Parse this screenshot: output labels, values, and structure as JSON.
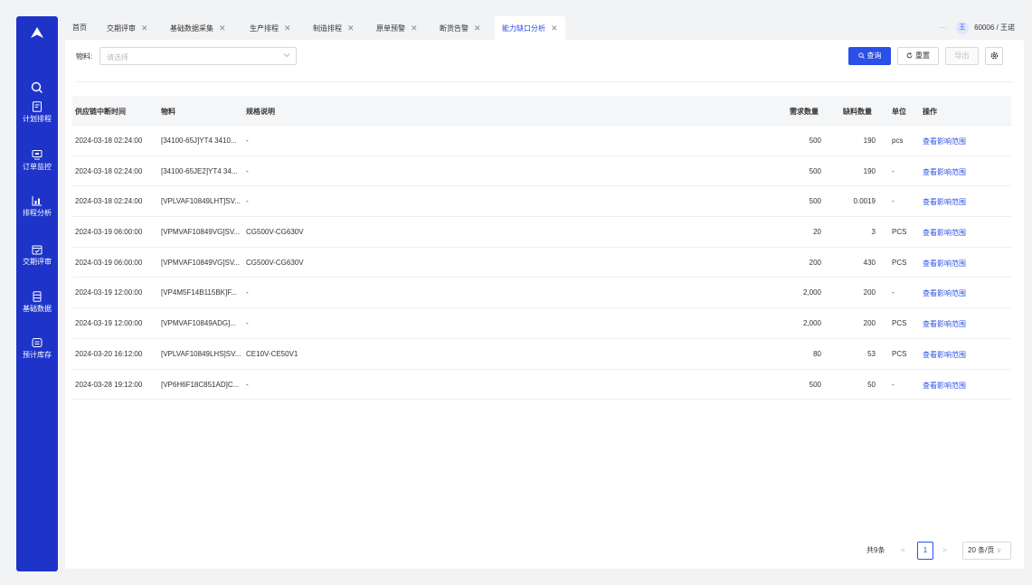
{
  "sidebar": {
    "logo_icon": "triangle-logo-icon",
    "search_icon": "search-icon",
    "items": [
      {
        "label": "计划排程",
        "icon": "document-icon"
      },
      {
        "label": "订单监控",
        "icon": "monitor-icon"
      },
      {
        "label": "排程分析",
        "icon": "chart-icon"
      },
      {
        "label": "交期评审",
        "icon": "calendar-icon"
      },
      {
        "label": "基础数据",
        "icon": "database-icon"
      },
      {
        "label": "预计库存",
        "icon": "box-icon"
      }
    ]
  },
  "tabs": [
    {
      "label": "首页",
      "closable": false
    },
    {
      "label": "交期评审",
      "closable": true
    },
    {
      "label": "基础数据采集",
      "closable": true
    },
    {
      "label": "生产排程",
      "closable": true
    },
    {
      "label": "制造排程",
      "closable": true
    },
    {
      "label": "原单预警",
      "closable": true
    },
    {
      "label": "断货告警",
      "closable": true
    },
    {
      "label": "能力缺口分析",
      "closable": true,
      "active": true
    }
  ],
  "user": {
    "more": "···",
    "avatar": "王",
    "name": "60006 / 王诺"
  },
  "filter": {
    "label": "物料:",
    "placeholder": "请选择"
  },
  "toolbar": {
    "query": "查询",
    "reset": "重置",
    "export": "导出",
    "settings_icon": "settings-icon"
  },
  "table": {
    "columns": [
      "供应链中断时间",
      "物料",
      "规格说明",
      "需求数量",
      "缺料数量",
      "单位",
      "操作"
    ],
    "rows": [
      [
        "2024-03-18 02:24:00",
        "[34100-65J]YT4 3410...",
        "-",
        "500",
        "190",
        "pcs",
        "查看影响范围"
      ],
      [
        "2024-03-18 02:24:00",
        "[34100-65JE2]YT4 34...",
        "-",
        "500",
        "190",
        "-",
        "查看影响范围"
      ],
      [
        "2024-03-18 02:24:00",
        "[VPLVAF10849LHT]SV...",
        "-",
        "500",
        "0.0019",
        "-",
        "查看影响范围"
      ],
      [
        "2024-03-19 06:00:00",
        "[VPMVAF10849VG]SV...",
        "CG500V-CG630V",
        "20",
        "3",
        "PCS",
        "查看影响范围"
      ],
      [
        "2024-03-19 06:00:00",
        "[VPMVAF10849VG]SV...",
        "CG500V-CG630V",
        "200",
        "430",
        "PCS",
        "查看影响范围"
      ],
      [
        "2024-03-19 12:00:00",
        "[VP4M5F14B115BK]F...",
        "-",
        "2,000",
        "200",
        "-",
        "查看影响范围"
      ],
      [
        "2024-03-19 12:00:00",
        "[VPMVAF10849ADG]...",
        "-",
        "2,000",
        "200",
        "PCS",
        "查看影响范围"
      ],
      [
        "2024-03-20 16:12:00",
        "[VPLVAF10849LHS]SV...",
        "CE10V-CE50V1",
        "80",
        "53",
        "PCS",
        "查看影响范围"
      ],
      [
        "2024-03-28 19:12:00",
        "[VP6H6F18C851AD]C...",
        "-",
        "500",
        "50",
        "-",
        "查看影响范围"
      ]
    ]
  },
  "pagination": {
    "total": "共9条",
    "prev": "<",
    "current": "1",
    "next": ">",
    "page_size": "20 条/页"
  },
  "colors": {
    "primary": "#2b50e8",
    "sidebar": "#1e34c8"
  }
}
